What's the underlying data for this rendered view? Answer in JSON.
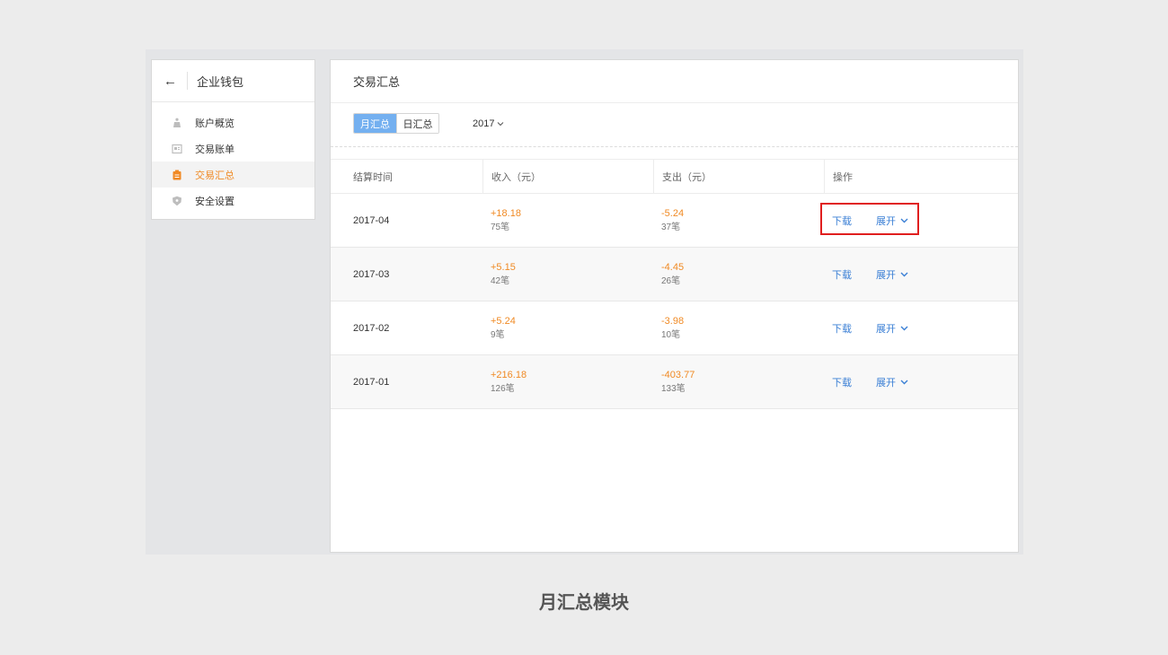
{
  "sidebar": {
    "title": "企业钱包",
    "items": [
      {
        "label": "账户概览",
        "icon": "moneybag-icon",
        "active": false
      },
      {
        "label": "交易账单",
        "icon": "bill-icon",
        "active": false
      },
      {
        "label": "交易汇总",
        "icon": "clipboard-icon",
        "active": true
      },
      {
        "label": "安全设置",
        "icon": "shield-icon",
        "active": false
      }
    ]
  },
  "main": {
    "title": "交易汇总",
    "tabs": [
      {
        "label": "月汇总",
        "active": true
      },
      {
        "label": "日汇总",
        "active": false
      }
    ],
    "year": "2017",
    "table": {
      "headers": [
        "结算时间",
        "收入（元）",
        "支出（元）",
        "操作"
      ],
      "rows": [
        {
          "date": "2017-04",
          "income": "+18.18",
          "income_count": "75笔",
          "expense": "-5.24",
          "expense_count": "37笔"
        },
        {
          "date": "2017-03",
          "income": "+5.15",
          "income_count": "42笔",
          "expense": "-4.45",
          "expense_count": "26笔"
        },
        {
          "date": "2017-02",
          "income": "+5.24",
          "income_count": "9笔",
          "expense": "-3.98",
          "expense_count": "10笔"
        },
        {
          "date": "2017-01",
          "income": "+216.18",
          "income_count": "126笔",
          "expense": "-403.77",
          "expense_count": "133笔"
        }
      ],
      "download_label": "下载",
      "expand_label": "展开"
    }
  },
  "caption": "月汇总模块",
  "colors": {
    "accent_orange": "#f08a24",
    "link_blue": "#3a7fd5",
    "tab_active": "#74b0f0",
    "highlight_red": "#e01f1f"
  }
}
